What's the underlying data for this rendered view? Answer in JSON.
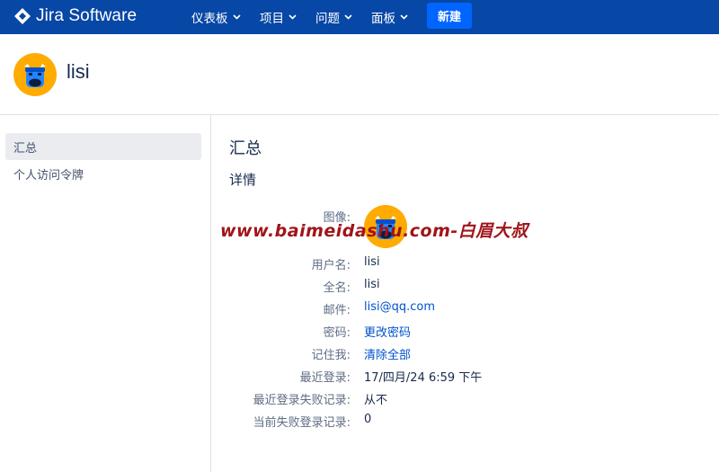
{
  "topnav": {
    "logo_text": "Jira Software",
    "menus": [
      {
        "label": "仪表板"
      },
      {
        "label": "项目"
      },
      {
        "label": "问题"
      },
      {
        "label": "面板"
      }
    ],
    "create_label": "新建",
    "colors": {
      "bar": "#0747a6",
      "create": "#0065ff"
    }
  },
  "profile": {
    "name": "lisi",
    "avatar_icon": "cow-avatar-icon"
  },
  "sidebar": {
    "items": [
      {
        "label": "汇总",
        "active": true
      },
      {
        "label": "个人访问令牌",
        "active": false
      }
    ]
  },
  "main": {
    "title": "汇总",
    "section": "详情",
    "fields": {
      "avatar_label": "图像:",
      "username_label": "用户名:",
      "username": "lisi",
      "fullname_label": "全名:",
      "fullname": "lisi",
      "email_label": "邮件:",
      "email": "lisi@qq.com",
      "password_label": "密码:",
      "password_action": "更改密码",
      "remember_label": "记住我:",
      "remember_action": "清除全部",
      "last_login_label": "最近登录:",
      "last_login": "17/四月/24 6:59 下午",
      "last_failed_label": "最近登录失败记录:",
      "last_failed": "从不",
      "current_failed_label": "当前失败登录记录:",
      "current_failed": "0"
    }
  },
  "watermark": "www.baimeidashu.com-白眉大叔"
}
